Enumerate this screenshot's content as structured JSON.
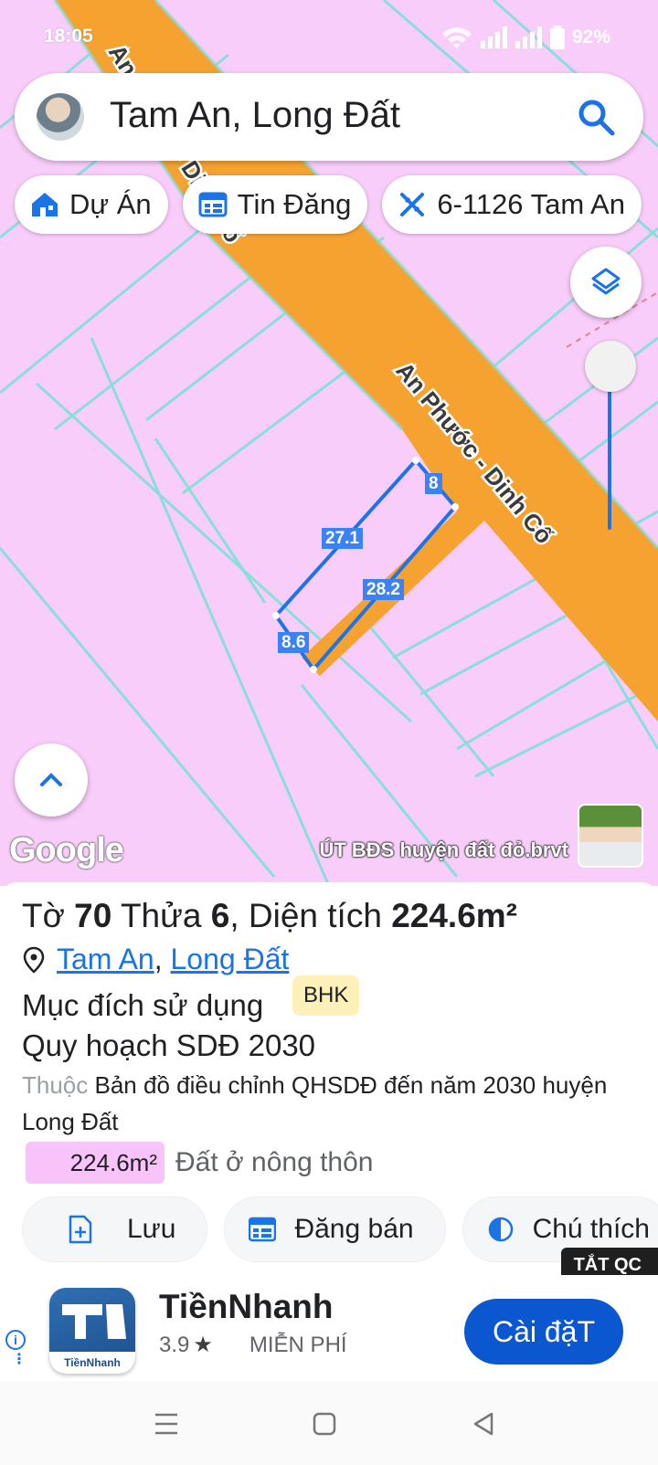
{
  "status_bar": {
    "time": "18:05",
    "battery": "92%"
  },
  "search": {
    "query": "Tam An, Long Đất"
  },
  "chips": [
    {
      "label": "Dự Án",
      "icon": "house-icon"
    },
    {
      "label": "Tin Đăng",
      "icon": "listing-icon"
    },
    {
      "label": "6-1126 Tam An",
      "icon": "ruler-icon"
    }
  ],
  "map": {
    "road_label": "An Phước - Dinh Cố",
    "road_label_top": "An Phước - Dinh Cố",
    "edge_lengths": {
      "top": "8",
      "left": "27.1",
      "right": "28.2",
      "bottom": "8.6"
    },
    "google_logo": "Google",
    "watermark": "ÚT BĐS huyện đất đỏ.brvt",
    "colors": {
      "land": "#f8cdfa",
      "road": "#f5a230",
      "parcel_outline": "#1e73e8"
    }
  },
  "parcel": {
    "title_prefix": "Tờ",
    "sheet_no": "70",
    "title_mid": "Thửa",
    "parcel_no": "6",
    "title_area_label": ", Diện tích",
    "area": "224.6m²",
    "location_1": "Tam An",
    "location_2": "Long Đất",
    "purpose_label": "Mục đích sử dụng",
    "purpose_code": "BHK",
    "plan": "Quy hoạch SDĐ 2030",
    "belongs_prefix": "Thuộc",
    "belongs_text": "Bản đồ điều chỉnh QHSDĐ đến năm 2030 huyện Long Đất",
    "area_swatch": "224.6m²",
    "land_type": "Đất ở nông thôn"
  },
  "actions": [
    {
      "label": "Lưu",
      "icon": "save-file-icon"
    },
    {
      "label": "Đăng bán",
      "icon": "listing-icon"
    },
    {
      "label": "Chú thích",
      "icon": "contrast-icon"
    }
  ],
  "ad": {
    "close_label": "TẮT QC",
    "app_name": "TiềnNhanh",
    "app_icon_text": "TiềnNhanh",
    "rating": "3.9",
    "price": "MIỄN PHÍ",
    "install_label": "Cài đặT"
  }
}
